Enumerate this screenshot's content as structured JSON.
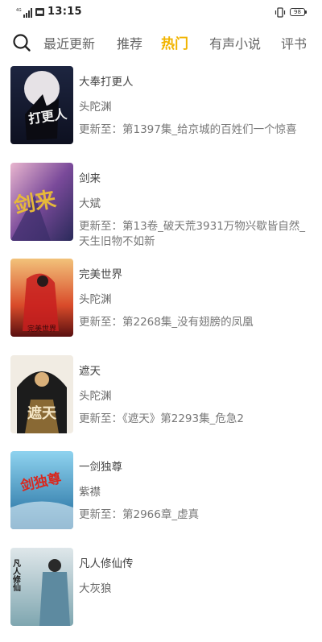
{
  "status_bar": {
    "network": "4G",
    "time": "13:15",
    "battery": "98"
  },
  "tabs": [
    {
      "label": "最近更新"
    },
    {
      "label": "推荐"
    },
    {
      "label": "热门"
    },
    {
      "label": "有声小说"
    },
    {
      "label": "评书"
    }
  ],
  "active_tab": "热门",
  "books": [
    {
      "title": "大奉打更人",
      "author": "头陀渊",
      "update": "更新至：第1397集_给京城的百姓们一个惊喜",
      "cover_text": "打更人"
    },
    {
      "title": "剑来",
      "author": "大斌",
      "update": "更新至：第13卷_破天荒3931万物兴歇皆自然_天生旧物不如新",
      "cover_text": "剑来"
    },
    {
      "title": "完美世界",
      "author": "头陀渊",
      "update": "更新至：第2268集_没有翅膀的凤凰",
      "cover_text": "完美世界"
    },
    {
      "title": "遮天",
      "author": "头陀渊",
      "update": "更新至：《遮天》第2293集_危急2",
      "cover_text": "遮天"
    },
    {
      "title": "一剑独尊",
      "author": "紫襟",
      "update": "更新至：第2966章_虚真",
      "cover_text": "剑独尊"
    },
    {
      "title": "凡人修仙传",
      "author": "大灰狼",
      "update": "",
      "cover_text": "凡人修仙"
    }
  ]
}
